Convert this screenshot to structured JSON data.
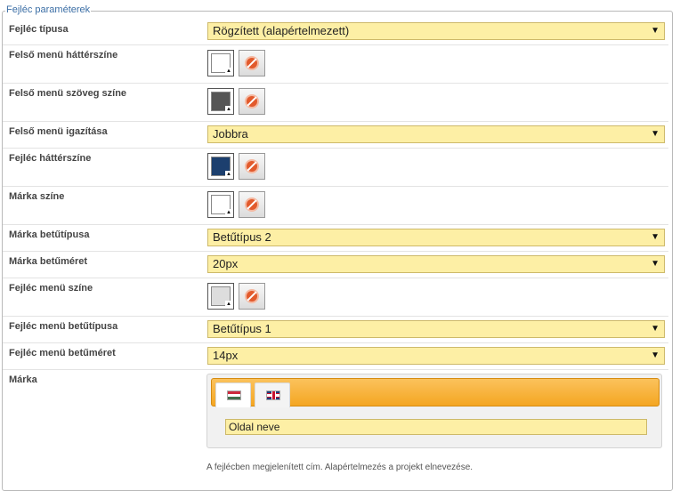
{
  "legend": "Fejléc paraméterek",
  "rows": {
    "header_type": {
      "label": "Fejléc típusa",
      "value": "Rögzített (alapértelmezett)"
    },
    "top_menu_bg": {
      "label": "Felső menü háttérszíne",
      "color": "#ffffff"
    },
    "top_menu_text": {
      "label": "Felső menü szöveg színe",
      "color": "#555555"
    },
    "top_menu_align": {
      "label": "Felső menü igazítása",
      "value": "Jobbra"
    },
    "header_bg": {
      "label": "Fejléc háttérszíne",
      "color": "#1c3f6e"
    },
    "brand_color": {
      "label": "Márka színe",
      "color": "#ffffff"
    },
    "brand_font": {
      "label": "Márka betűtípusa",
      "value": "Betűtípus 2"
    },
    "brand_size": {
      "label": "Márka betűméret",
      "value": "20px"
    },
    "header_menu_color": {
      "label": "Fejléc menü színe",
      "color": "#dddddd"
    },
    "header_menu_font": {
      "label": "Fejléc menü betűtípusa",
      "value": "Betűtípus 1"
    },
    "header_menu_size": {
      "label": "Fejléc menü betűméret",
      "value": "14px"
    },
    "brand": {
      "label": "Márka",
      "value": "Oldal neve",
      "hint": "A fejlécben megjelenített cím. Alapértelmezés a projekt elnevezése."
    }
  },
  "icons": {
    "dropdown": "▼",
    "swatch_corner": "▲"
  },
  "accent": "#f4a622"
}
